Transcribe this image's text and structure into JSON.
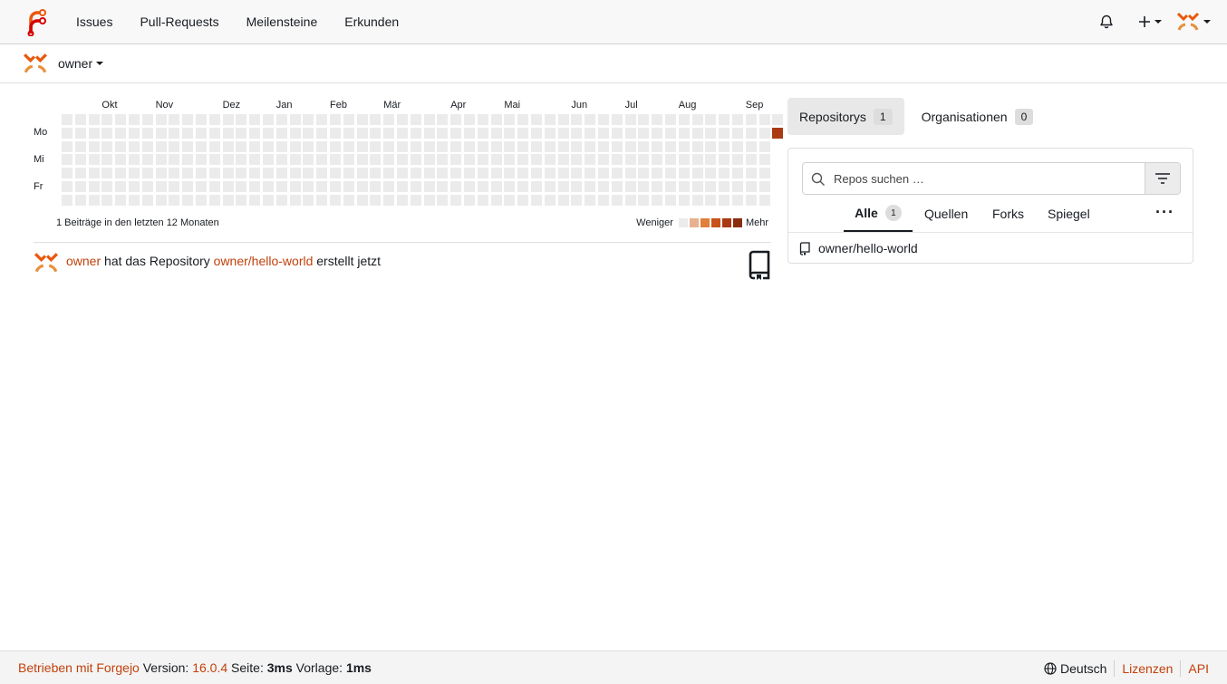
{
  "nav": {
    "items": [
      "Issues",
      "Pull-Requests",
      "Meilensteine",
      "Erkunden"
    ],
    "notifications_icon": "bell-icon",
    "create_icon": "plus-icon",
    "avatar_icon": "user-avatar"
  },
  "subheader": {
    "owner": "owner"
  },
  "heatmap": {
    "months": [
      "Okt",
      "Nov",
      "Dez",
      "Jan",
      "Feb",
      "Mär",
      "Apr",
      "Mai",
      "Jun",
      "Jul",
      "Aug",
      "Sep"
    ],
    "days": [
      "Mo",
      "Mi",
      "Fr"
    ],
    "summary": "1 Beiträge in den letzten 12 Monaten",
    "less": "Weniger",
    "more": "Mehr",
    "levels": [
      "#ebebeb",
      "#e8b08f",
      "#e0803c",
      "#c8521a",
      "#a93a14",
      "#8a2c10"
    ],
    "active_color": "#a93a14",
    "contributions": [
      {
        "week": 53,
        "day": 1,
        "level": 4
      }
    ]
  },
  "feed": {
    "user": "owner",
    "text_mid": " hat das Repository ",
    "repo": "owner/hello-world",
    "text_end": " erstellt jetzt",
    "icon": "repo-icon"
  },
  "tabs": [
    {
      "label": "Repositorys",
      "count": "1"
    },
    {
      "label": "Organisationen",
      "count": "0"
    }
  ],
  "repo_search": {
    "placeholder": "Repos suchen …",
    "filter_icon": "filter-icon"
  },
  "repo_tabs": [
    {
      "label": "Alle",
      "count": "1"
    },
    {
      "label": "Quellen"
    },
    {
      "label": "Forks"
    },
    {
      "label": "Spiegel"
    }
  ],
  "repos": [
    {
      "name": "owner/hello-world"
    }
  ],
  "footer": {
    "powered_by": "Betrieben mit Forgejo",
    "version_label": " Version: ",
    "version": "16.0.4",
    "page_label": " Seite: ",
    "page_time": "3ms",
    "template_label": " Vorlage: ",
    "template_time": "1ms",
    "language": "Deutsch",
    "licenses": "Lizenzen",
    "api": "API"
  },
  "colors": {
    "accent": "#c2410c",
    "logo_orange": "#ea580c",
    "logo_red": "#d40000"
  }
}
